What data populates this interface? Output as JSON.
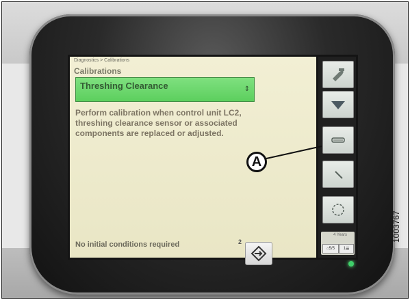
{
  "screen": {
    "breadcrumb": "Diagnostics > Calibrations",
    "title": "Calibrations",
    "selector": {
      "label": "Threshing Clearance",
      "arrows": "⇕"
    },
    "description": "Perform calibration when control unit LC2, threshing clearance sensor or associated components are replaced or adjusted.",
    "footer": "No initial conditions required",
    "footer_superscript": "2",
    "colors": {
      "selector_green": "#5ccf5e",
      "background": "#f2efd4"
    }
  },
  "sidebar": {
    "buttons": [
      {
        "icon": "tools-icon"
      },
      {
        "icon": "arrow-down-icon"
      },
      {
        "icon": "gauge-icon"
      },
      {
        "icon": "pencil-icon"
      },
      {
        "icon": "refresh-circle-icon"
      }
    ],
    "status_text": "4 Years",
    "mini_left": "5/5",
    "mini_right": "1"
  },
  "callout": {
    "letter": "A"
  },
  "figure_code": "1003767"
}
